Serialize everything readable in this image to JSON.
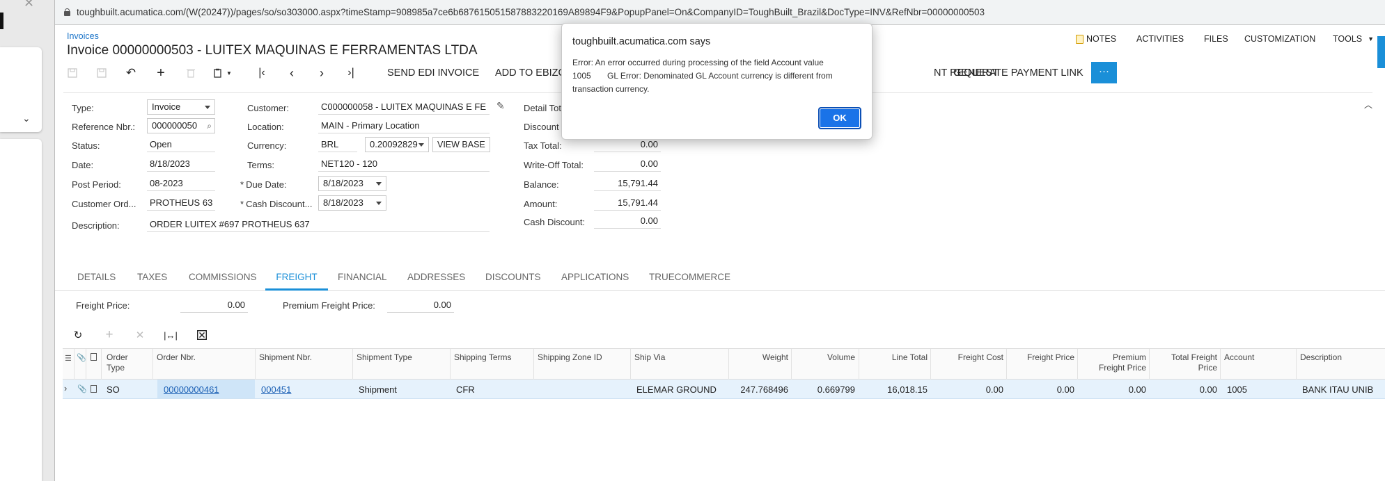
{
  "browser": {
    "url": "toughbuilt.acumatica.com/(W(20247))/pages/so/so303000.aspx?timeStamp=908985a7ce6b687615051587883220169A89894F9&PopupPanel=On&CompanyID=ToughBuilt_Brazil&DocType=INV&RefNbr=00000000503"
  },
  "header": {
    "breadcrumb": "Invoices",
    "title": "Invoice 00000000503 - LUITEX MAQUINAS E FERRAMENTAS LTDA",
    "menu": {
      "notes": "NOTES",
      "activities": "ACTIVITIES",
      "files": "FILES",
      "customization": "CUSTOMIZATION",
      "tools": "TOOLS"
    }
  },
  "toolbar": {
    "send_edi": "SEND EDI INVOICE",
    "add_to_ebizc": "ADD TO EBIZC",
    "payment_request": "NT REQUEST",
    "generate_payment_link": "GENERATE PAYMENT LINK",
    "more": "···"
  },
  "form": {
    "type_label": "Type:",
    "type_value": "Invoice",
    "refnbr_label": "Reference Nbr.:",
    "refnbr_value": "000000050",
    "status_label": "Status:",
    "status_value": "Open",
    "date_label": "Date:",
    "date_value": "8/18/2023",
    "postperiod_label": "Post Period:",
    "postperiod_value": "08-2023",
    "custorder_label": "Customer Ord...",
    "custorder_value": "PROTHEUS 63",
    "description_label": "Description:",
    "description_value": "ORDER LUITEX #697 PROTHEUS 637",
    "customer_label": "Customer:",
    "customer_value": "C000000058 - LUITEX MAQUINAS E FE",
    "location_label": "Location:",
    "location_value": "MAIN - Primary Location",
    "currency_label": "Currency:",
    "currency_value": "BRL",
    "rate_value": "0.20092829",
    "view_base": "VIEW BASE",
    "terms_label": "Terms:",
    "terms_value": "NET120 - 120",
    "duedate_label": "Due Date:",
    "duedate_value": "8/18/2023",
    "cashdiscount_date_label": "Cash Discount...",
    "cashdiscount_date_value": "8/18/2023",
    "required_mark": "*",
    "detail_total_label": "Detail Tot",
    "discount_label": "Discount",
    "tax_total_label": "Tax Total:",
    "tax_total_value": "0.00",
    "writeoff_label": "Write-Off Total:",
    "writeoff_value": "0.00",
    "balance_label": "Balance:",
    "balance_value": "15,791.44",
    "amount_label": "Amount:",
    "amount_value": "15,791.44",
    "cash_discount_label": "Cash Discount:",
    "cash_discount_value": "0.00"
  },
  "tabs": [
    "DETAILS",
    "TAXES",
    "COMMISSIONS",
    "FREIGHT",
    "FINANCIAL",
    "ADDRESSES",
    "DISCOUNTS",
    "APPLICATIONS",
    "TRUECOMMERCE"
  ],
  "active_tab": "FREIGHT",
  "freight": {
    "freight_price_label": "Freight Price:",
    "freight_price_value": "0.00",
    "premium_label": "Premium Freight Price:",
    "premium_value": "0.00"
  },
  "grid": {
    "headers": {
      "order_type": "Order\nType",
      "order_nbr": "Order Nbr.",
      "shipment_nbr": "Shipment Nbr.",
      "shipment_type": "Shipment Type",
      "shipping_terms": "Shipping Terms",
      "shipping_zone": "Shipping Zone ID",
      "ship_via": "Ship Via",
      "weight": "Weight",
      "volume": "Volume",
      "line_total": "Line Total",
      "freight_cost": "Freight Cost",
      "freight_price": "Freight Price",
      "premium_freight_price": "Premium\nFreight Price",
      "total_freight_price": "Total Freight\nPrice",
      "account": "Account",
      "description": "Description"
    },
    "row": {
      "order_type": "SO",
      "order_nbr": "00000000461",
      "shipment_nbr": "000451",
      "shipment_type": "Shipment",
      "shipping_terms": "CFR",
      "shipping_zone": "",
      "ship_via": "ELEMAR GROUND",
      "weight": "247.768496",
      "volume": "0.669799",
      "line_total": "16,018.15",
      "freight_cost": "0.00",
      "freight_price": "0.00",
      "premium_freight_price": "0.00",
      "total_freight_price": "0.00",
      "account": "1005",
      "description": "BANK ITAU UNIB"
    }
  },
  "dialog": {
    "title": "toughbuilt.acumatica.com says",
    "message": "Error: An error occurred during processing of the field Account value\n1005       GL Error: Denominated GL Account currency is different from\ntransaction currency.",
    "ok": "OK"
  },
  "colors": {
    "accent": "#1a8fd8",
    "link": "#1a5fb4",
    "selected_row": "#e6f2fc",
    "ok_button": "#1a73e8"
  }
}
